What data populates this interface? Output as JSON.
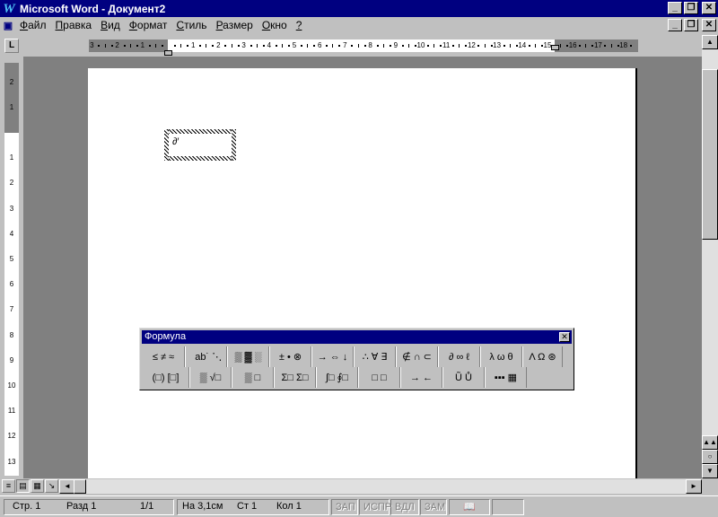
{
  "window": {
    "title": "Microsoft Word - Документ2",
    "app_icon": "W"
  },
  "menu": {
    "items": [
      "Файл",
      "Правка",
      "Вид",
      "Формат",
      "Стиль",
      "Размер",
      "Окно",
      "?"
    ]
  },
  "hruler": {
    "left_labels": [
      "3",
      "2",
      "1"
    ],
    "right_labels": [
      "1",
      "2",
      "3",
      "4",
      "5",
      "6",
      "7",
      "8",
      "9",
      "10",
      "11",
      "12",
      "13",
      "14",
      "15",
      "16",
      "17",
      "18"
    ]
  },
  "vruler": {
    "top_labels": [
      "2",
      "1"
    ],
    "labels": [
      "1",
      "2",
      "3",
      "4",
      "5",
      "6",
      "7",
      "8",
      "9",
      "10",
      "11",
      "12",
      "13"
    ]
  },
  "document": {
    "formula_placeholder": "∂′"
  },
  "formula_toolbar": {
    "title": "Формула",
    "row1": [
      "≤ ≠ ≈",
      " ab˙ ⋱",
      "▒ ▓ ░",
      "± • ⊗",
      "→ ⇔ ↓",
      "∴ ∀ ∃",
      "∉ ∩ ⊂",
      "∂ ∞ ℓ",
      "λ ω θ",
      "Λ Ω ⊛"
    ],
    "row2": [
      "(□) [□]",
      "▒ √□",
      "▒ □",
      "Σ□ Σ□",
      "∫□ ∮□",
      "□ □",
      "→ ←",
      "Ũ Ů",
      "▪▪▪ ▦"
    ]
  },
  "status": {
    "page": "Стр. 1",
    "section": "Разд 1",
    "pages": "1/1",
    "at": "На 3,1см",
    "line": "Ст 1",
    "col": "Кол 1",
    "rec": "ЗАП",
    "trk": "ИСПР",
    "ext": "ВДЛ",
    "ovr": "ЗАМ"
  }
}
